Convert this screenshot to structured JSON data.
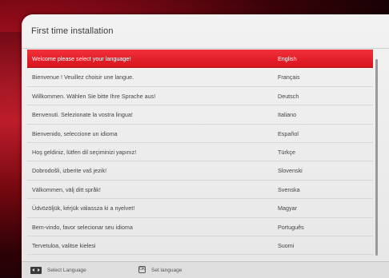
{
  "window": {
    "title": "First time installation"
  },
  "languages": [
    {
      "message": "Welcome please select your language!",
      "language": "English",
      "selected": true
    },
    {
      "message": "Bienvenue ! Veuillez choisir une langue.",
      "language": "Français",
      "selected": false
    },
    {
      "message": "Willkommen. Wählen Sie bitte Ihre Sprache aus!",
      "language": "Deutsch",
      "selected": false
    },
    {
      "message": "Benvenuti. Selezionate la vostra lingua!",
      "language": "Italiano",
      "selected": false
    },
    {
      "message": "Bienvenido, seleccione un idioma",
      "language": "Español",
      "selected": false
    },
    {
      "message": "Hoş geldiniz, lütfen dil seçiminizi yapınız!",
      "language": "Türkçe",
      "selected": false
    },
    {
      "message": "Dobrodošli, izberite vaš jezik!",
      "language": "Slovenski",
      "selected": false
    },
    {
      "message": "Välkommen, välj ditt språk!",
      "language": "Svenska",
      "selected": false
    },
    {
      "message": "Üdvözöljük, kérjük válassza ki a nyelvet!",
      "language": "Magyar",
      "selected": false
    },
    {
      "message": "Bem-vindo, favor selecionar seu idioma",
      "language": "Português",
      "selected": false
    },
    {
      "message": "Tervetuloa, valitse kielesi",
      "language": "Suomi",
      "selected": false
    }
  ],
  "footer": {
    "select_label": "Select Language",
    "set_label": "Set language",
    "ok_glyph": "OK"
  },
  "colors": {
    "selected_row": "#e01e28",
    "panel": "#ededed",
    "background": "#8a0a18"
  }
}
